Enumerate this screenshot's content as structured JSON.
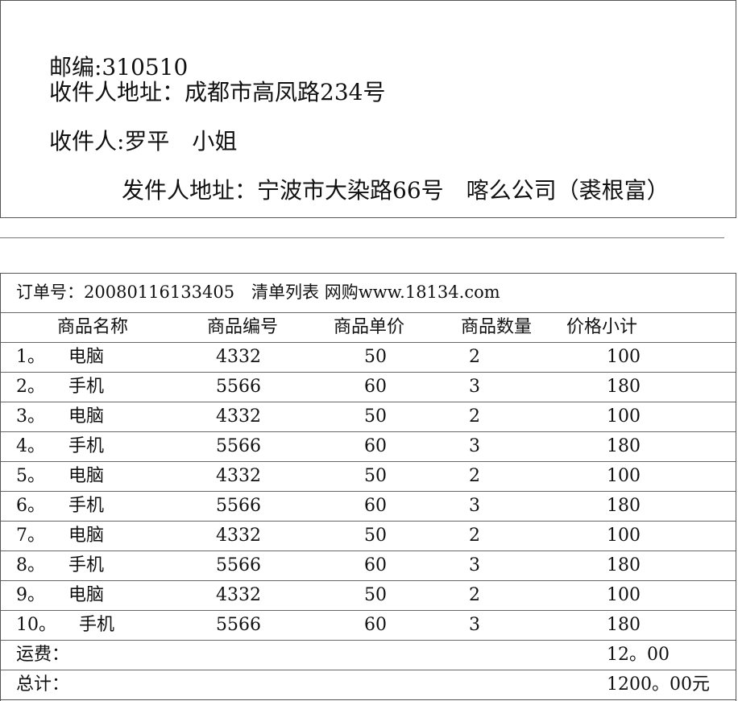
{
  "envelope": {
    "postcode": "邮编:310510",
    "recipient_address": "收件人地址：成都市高凤路234号",
    "recipient": "收件人:罗平　小姐",
    "sender_address": "发件人地址：宁波市大染路66号　喀么公司（裘根富）"
  },
  "order": {
    "header": "订单号：20080116133405　清单列表 网购www.18134.com",
    "columns": [
      "商品名称",
      "商品编号",
      "商品单价",
      "商品数量",
      "价格小计"
    ],
    "items": [
      {
        "index": "1。",
        "name": "电脑",
        "code": "4332",
        "price": "50",
        "qty": "2",
        "subtotal": "100"
      },
      {
        "index": "2。",
        "name": "手机",
        "code": "5566",
        "price": "60",
        "qty": "3",
        "subtotal": "180"
      },
      {
        "index": "3。",
        "name": "电脑",
        "code": "4332",
        "price": "50",
        "qty": "2",
        "subtotal": "100"
      },
      {
        "index": "4。",
        "name": "手机",
        "code": "5566",
        "price": "60",
        "qty": "3",
        "subtotal": "180"
      },
      {
        "index": "5。",
        "name": "电脑",
        "code": "4332",
        "price": "50",
        "qty": "2",
        "subtotal": "100"
      },
      {
        "index": "6。",
        "name": "手机",
        "code": "5566",
        "price": "60",
        "qty": "3",
        "subtotal": "180"
      },
      {
        "index": "7。",
        "name": "电脑",
        "code": "4332",
        "price": "50",
        "qty": "2",
        "subtotal": "100"
      },
      {
        "index": "8。",
        "name": "手机",
        "code": "5566",
        "price": "60",
        "qty": "3",
        "subtotal": "180"
      },
      {
        "index": "9。",
        "name": "电脑",
        "code": "4332",
        "price": "50",
        "qty": "2",
        "subtotal": "100"
      },
      {
        "index": "10。",
        "name": "手机",
        "code": "5566",
        "price": "60",
        "qty": "3",
        "subtotal": "180"
      }
    ],
    "shipping_label": "运费：",
    "shipping_value": "12。00",
    "total_label": "总计：",
    "total_value": "1200。00元"
  }
}
